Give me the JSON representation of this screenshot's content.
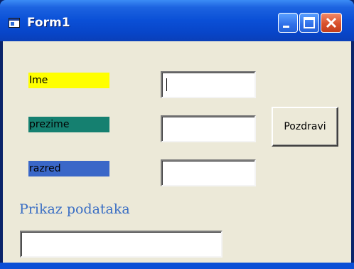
{
  "window": {
    "title": "Form1",
    "controls": [
      "minimize-icon",
      "maximize-icon",
      "close-icon"
    ]
  },
  "form": {
    "labels": {
      "ime": "Ime",
      "prezime": "prezime",
      "razred": "razred"
    },
    "fields": {
      "ime_value": "",
      "prezime_value": "",
      "razred_value": ""
    },
    "button_label": "Pozdravi",
    "heading": "Prikaz podataka",
    "output_value": ""
  },
  "colors": {
    "ime_label_bg": "#ffff00",
    "prezime_label_bg": "#158070",
    "razred_label_bg": "#3a67c8",
    "heading_text": "#3a6ec4",
    "titlebar": "#0a4fd6"
  }
}
